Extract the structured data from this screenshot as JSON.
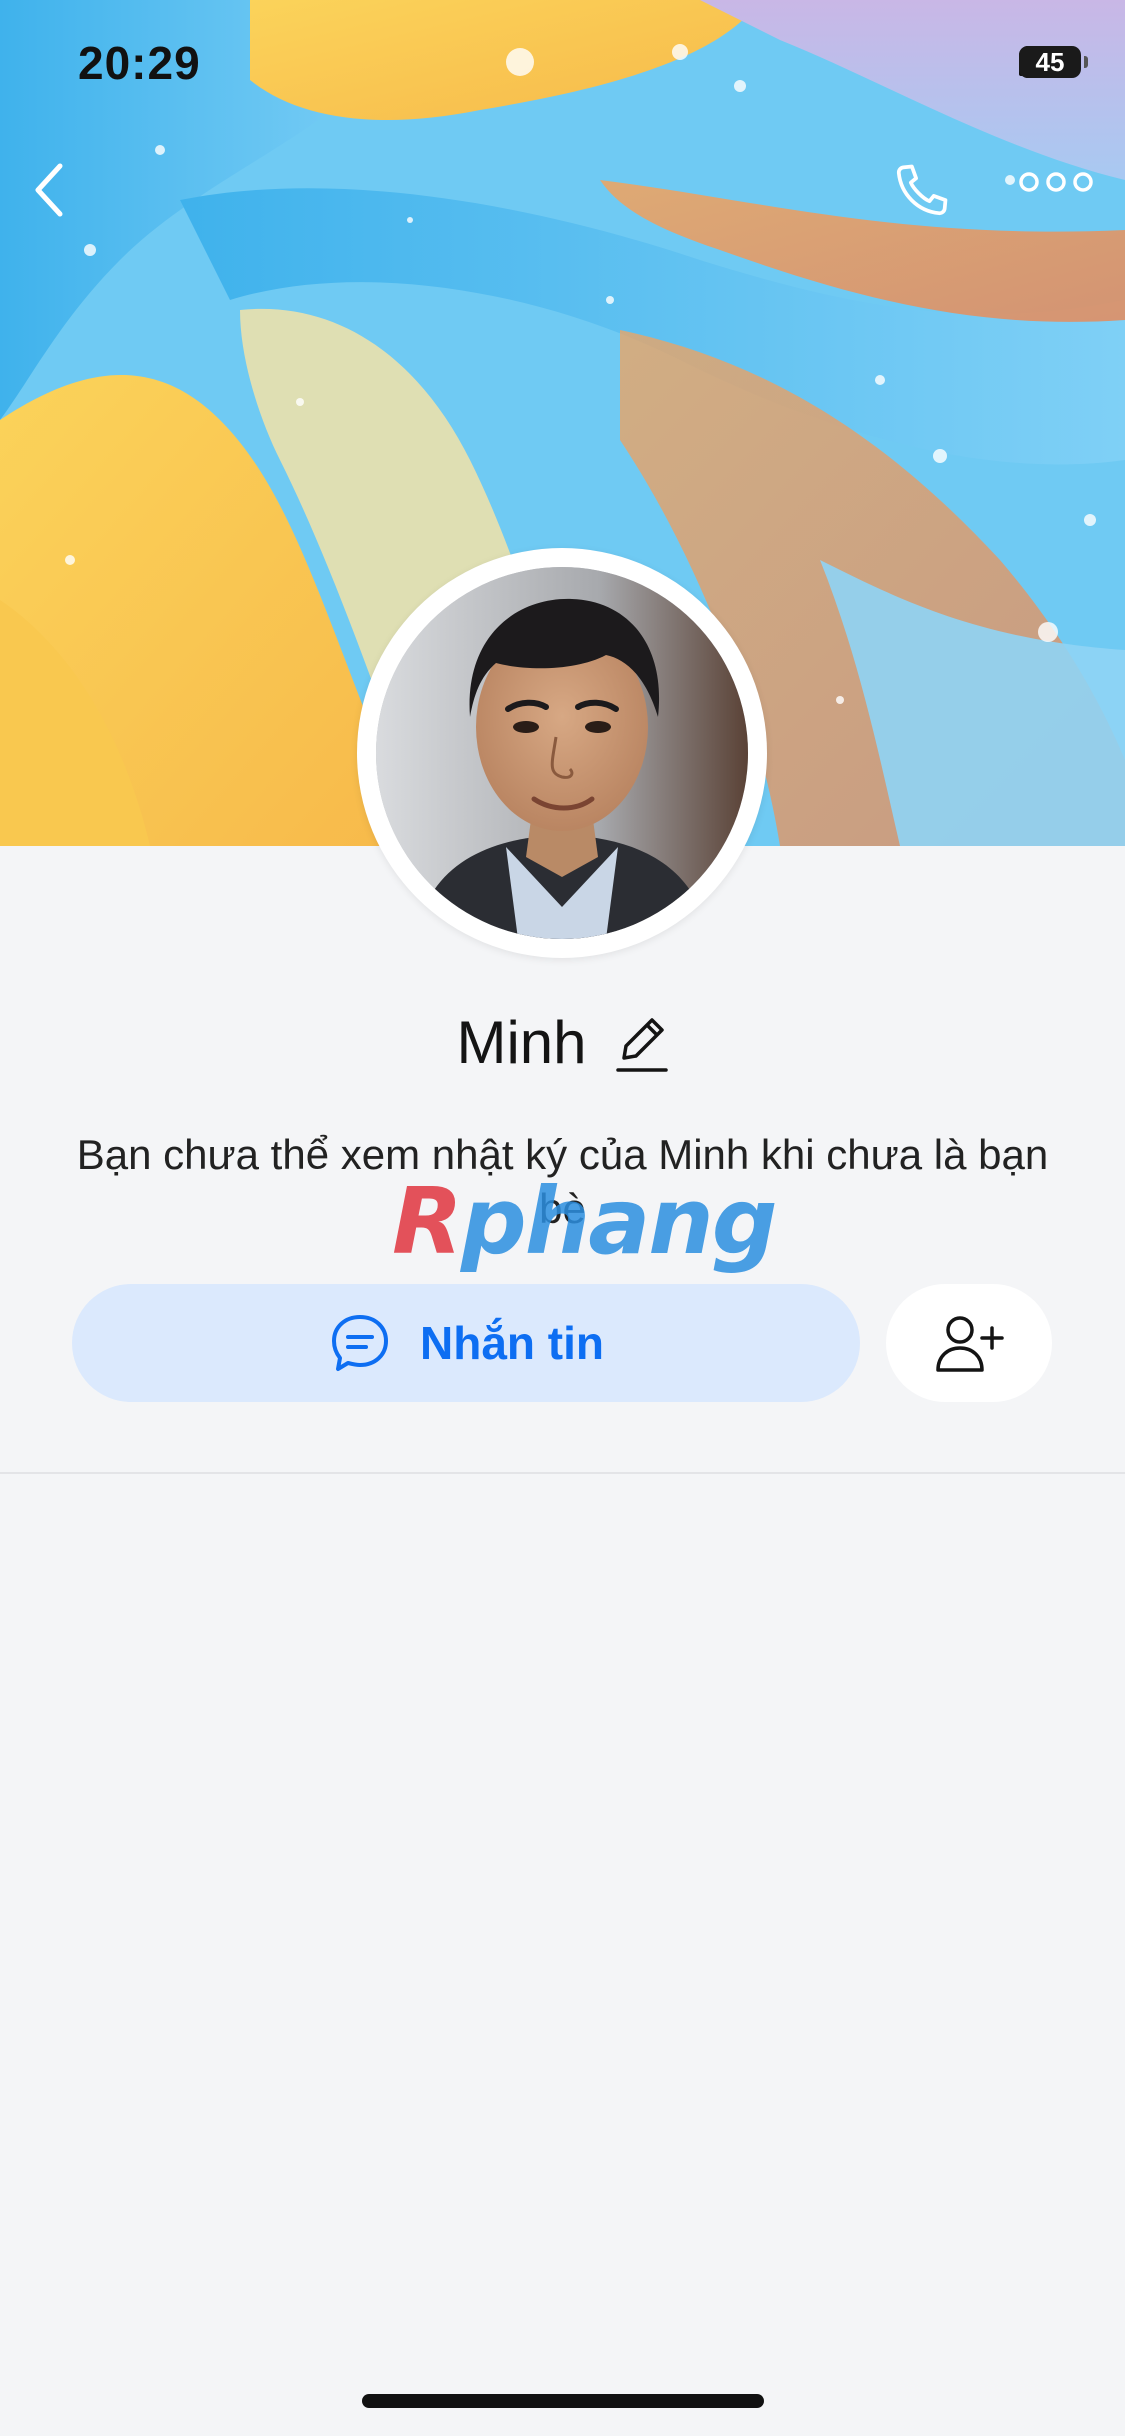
{
  "status_bar": {
    "time": "20:29",
    "battery_level": "45",
    "icons": [
      "signal-icon",
      "wifi-icon",
      "battery-icon"
    ]
  },
  "nav": {
    "icons": [
      "back-icon",
      "phone-icon",
      "more-icon"
    ]
  },
  "profile": {
    "name": "Minh",
    "notice": "Bạn chưa thể xem nhật ký của Minh khi chưa là bạn bè"
  },
  "watermark": {
    "part_red": "R",
    "part_blue": "phang"
  },
  "actions": {
    "message_label": "Nhắn tin",
    "message_icon": "chat-bubble-icon",
    "add_friend_icon": "add-friend-icon"
  },
  "colors": {
    "accent": "#0d6ef2",
    "message_button_bg": "#dbe9fd",
    "page_bg": "#f4f5f7"
  }
}
